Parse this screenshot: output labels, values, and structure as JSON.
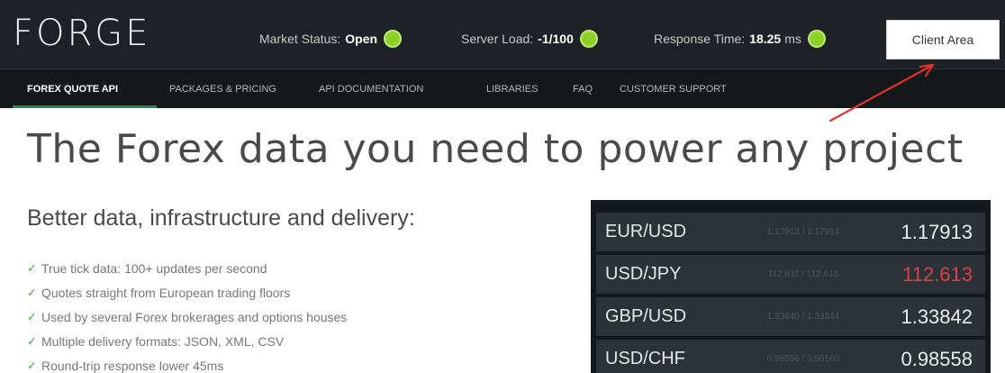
{
  "header": {
    "logo": "FORGE",
    "market_status": {
      "label": "Market Status:",
      "value": "Open"
    },
    "server_load": {
      "label": "Server Load:",
      "value": "-1/100"
    },
    "response_time": {
      "label": "Response Time:",
      "value": "18.25",
      "unit": "ms"
    },
    "status_color": "#8cd12a",
    "client_area_label": "Client Area"
  },
  "nav": {
    "items": [
      {
        "label": "FOREX QUOTE API",
        "active": true
      },
      {
        "label": "PACKAGES & PRICING",
        "active": false
      },
      {
        "label": "API DOCUMENTATION",
        "active": false
      },
      {
        "label": "LIBRARIES",
        "active": false
      },
      {
        "label": "FAQ",
        "active": false
      },
      {
        "label": "CUSTOMER SUPPORT",
        "active": false
      }
    ],
    "active_color": "#1f8e4a"
  },
  "annotation": {
    "type": "arrow",
    "color": "#e0322a"
  },
  "main": {
    "headline": "The Forex data you need to power any project",
    "subhead": "Better data, infrastructure and delivery:",
    "features": [
      "True tick data: 100+ updates per second",
      "Quotes straight from European trading floors",
      "Used by several Forex brokerages and options houses",
      "Multiple delivery formats: JSON, XML, CSV",
      "Round-trip response lower 45ms"
    ]
  },
  "quotes": [
    {
      "pair": "EUR/USD",
      "bid_ask": "1.17912 / 1.17914",
      "price": "1.17913",
      "direction": "neutral"
    },
    {
      "pair": "USD/JPY",
      "bid_ask": "112.611 / 112.615",
      "price": "112.613",
      "direction": "down"
    },
    {
      "pair": "GBP/USD",
      "bid_ask": "1.33840 / 1.33844",
      "price": "1.33842",
      "direction": "neutral"
    },
    {
      "pair": "USD/CHF",
      "bid_ask": "0.98556 / 0.98560",
      "price": "0.98558",
      "direction": "neutral"
    }
  ],
  "colors": {
    "header_bg": "#1e2226",
    "nav_bg": "#16191c",
    "price_down": "#d8434a"
  }
}
